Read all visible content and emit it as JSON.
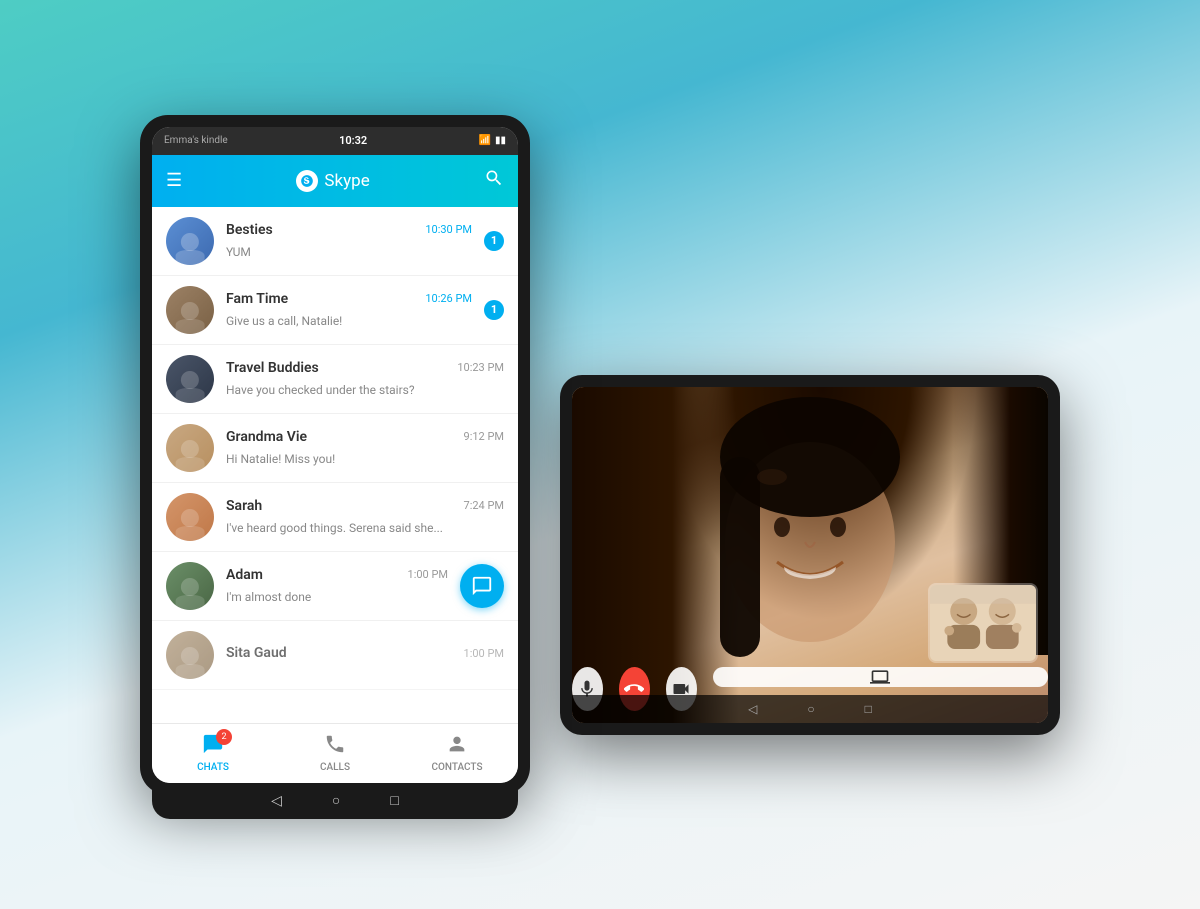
{
  "background": {
    "gradient_start": "#4ecdc4",
    "gradient_end": "#f5f5f5"
  },
  "tablet_portrait": {
    "device_name": "Emma's kindle",
    "time": "10:32",
    "wifi_icon": "wifi",
    "battery_icon": "battery",
    "header": {
      "menu_icon": "≡",
      "skype_logo": "S",
      "app_name": "Skype",
      "search_icon": "🔍"
    },
    "chats": [
      {
        "name": "Besties",
        "preview": "YUM",
        "time": "10:30 PM",
        "time_highlighted": true,
        "badge": "1",
        "avatar_style": "besties"
      },
      {
        "name": "Fam Time",
        "preview": "Give us a call, Natalie!",
        "time": "10:26 PM",
        "time_highlighted": true,
        "badge": "1",
        "avatar_style": "fam"
      },
      {
        "name": "Travel Buddies",
        "preview": "Have you checked under the stairs?",
        "time": "10:23 PM",
        "time_highlighted": false,
        "badge": null,
        "avatar_style": "travel"
      },
      {
        "name": "Grandma Vie",
        "preview": "Hi Natalie! Miss you!",
        "time": "9:12 PM",
        "time_highlighted": false,
        "badge": null,
        "avatar_style": "grandma"
      },
      {
        "name": "Sarah",
        "preview": "I've heard good things. Serena said she...",
        "time": "7:24 PM",
        "time_highlighted": false,
        "badge": null,
        "avatar_style": "sarah"
      },
      {
        "name": "Adam",
        "preview": "I'm almost done",
        "time": "1:00 PM",
        "time_highlighted": false,
        "badge": null,
        "compose_btn": true,
        "avatar_style": "adam"
      },
      {
        "name": "Sita Gaud",
        "preview": "",
        "time": "1:00 PM",
        "time_highlighted": false,
        "badge": null,
        "avatar_style": "sita"
      }
    ],
    "bottom_nav": [
      {
        "id": "chats",
        "label": "CHATS",
        "icon": "💬",
        "active": true,
        "badge": "2"
      },
      {
        "id": "calls",
        "label": "CALLS",
        "icon": "📞",
        "active": false,
        "badge": null
      },
      {
        "id": "contacts",
        "label": "CONTACTS",
        "icon": "👤",
        "active": false,
        "badge": null
      }
    ],
    "android_nav": {
      "back": "◁",
      "home": "○",
      "recent": "□"
    }
  },
  "tablet_landscape": {
    "video_call": {
      "main_participant": "Remote caller (woman)",
      "thumbnail_participants": "Two people waving"
    },
    "controls": [
      {
        "id": "mic",
        "icon": "🎤",
        "type": "mic"
      },
      {
        "id": "end",
        "icon": "📞",
        "type": "end"
      },
      {
        "id": "video",
        "icon": "📹",
        "type": "video"
      },
      {
        "id": "screen",
        "icon": "📺",
        "type": "screen"
      }
    ],
    "android_nav": {
      "back": "◁",
      "home": "○",
      "recent": "□"
    }
  }
}
